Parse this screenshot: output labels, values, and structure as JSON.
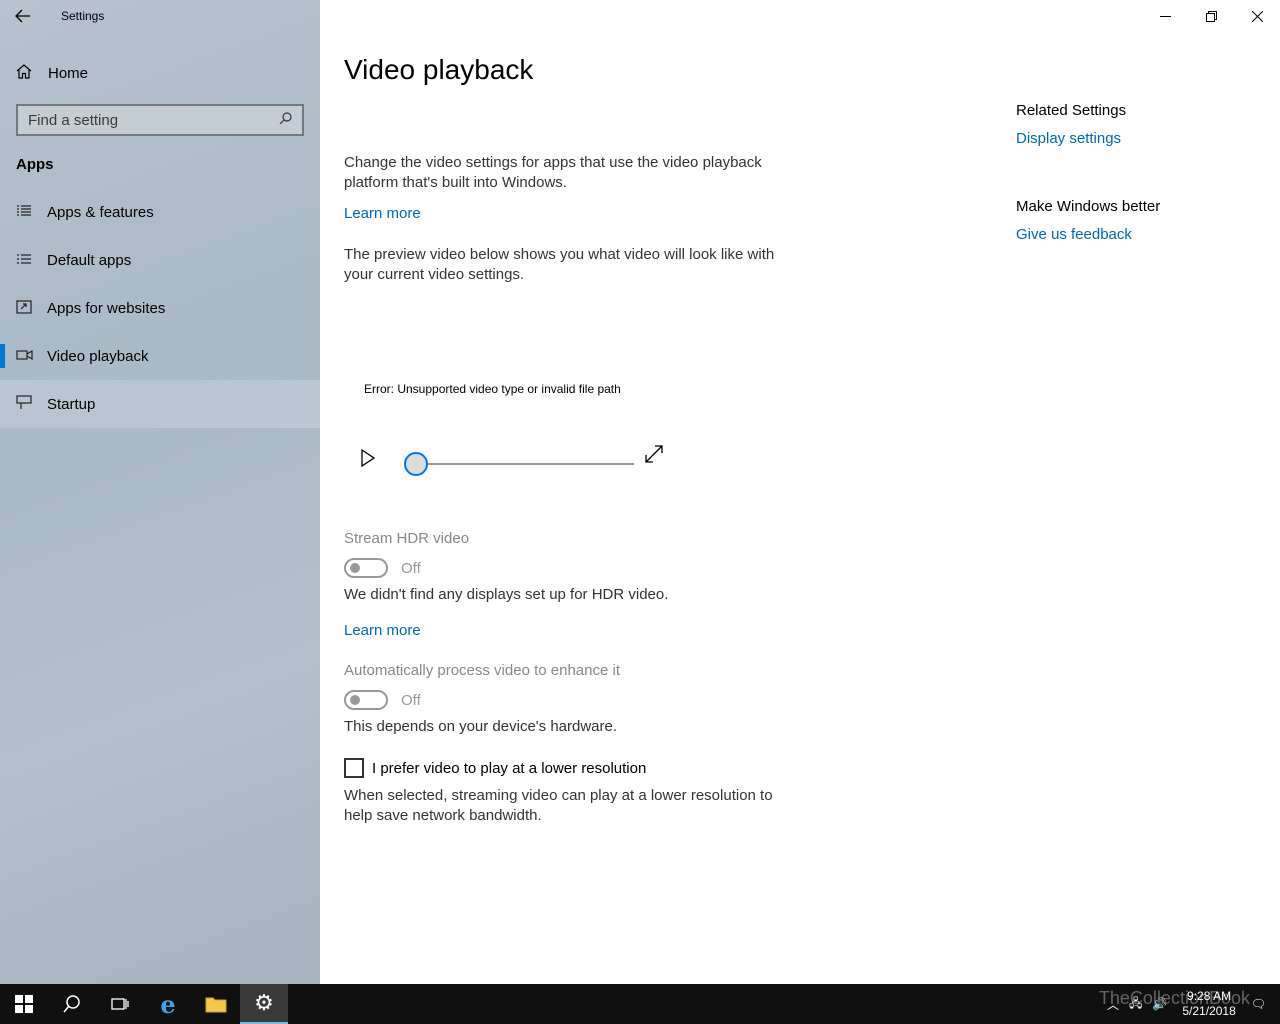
{
  "window": {
    "app_title": "Settings",
    "back_icon": "back-arrow-icon",
    "controls": {
      "minimize": "—",
      "restore": "❐",
      "close": "✕"
    }
  },
  "sidebar": {
    "home_label": "Home",
    "search_placeholder": "Find a setting",
    "section_label": "Apps",
    "items": [
      {
        "label": "Apps & features",
        "icon": "apps-features-icon"
      },
      {
        "label": "Default apps",
        "icon": "default-apps-icon"
      },
      {
        "label": "Apps for websites",
        "icon": "apps-websites-icon"
      },
      {
        "label": "Video playback",
        "icon": "video-icon",
        "active": true
      },
      {
        "label": "Startup",
        "icon": "startup-icon"
      }
    ]
  },
  "main": {
    "title": "Video playback",
    "intro": "Change the video settings for apps that use the video playback platform that's built into Windows.",
    "learn_more_1": "Learn more",
    "preview_text": "The preview video below shows you what video will look like with your current video settings.",
    "video_error": "Error: Unsupported video type or invalid file path",
    "playback_progress": 0,
    "hdr": {
      "label": "Stream HDR video",
      "state": "Off",
      "desc": "We didn't find any displays set up for HDR video.",
      "learn_more": "Learn more"
    },
    "enhance": {
      "label": "Automatically process video to enhance it",
      "state": "Off",
      "desc": "This depends on your device's hardware."
    },
    "low_res": {
      "label": "I prefer video to play at a lower resolution",
      "checked": false,
      "desc": "When selected, streaming video can play at a lower resolution to help save network bandwidth."
    }
  },
  "related": {
    "header": "Related Settings",
    "display_link": "Display settings",
    "better_header": "Make Windows better",
    "feedback_link": "Give us feedback"
  },
  "taskbar": {
    "time": "9:28 AM",
    "date": "5/21/2018",
    "watermark": "TheCollectionBook"
  },
  "colors": {
    "accent": "#0078d7",
    "link": "#0067b8"
  }
}
